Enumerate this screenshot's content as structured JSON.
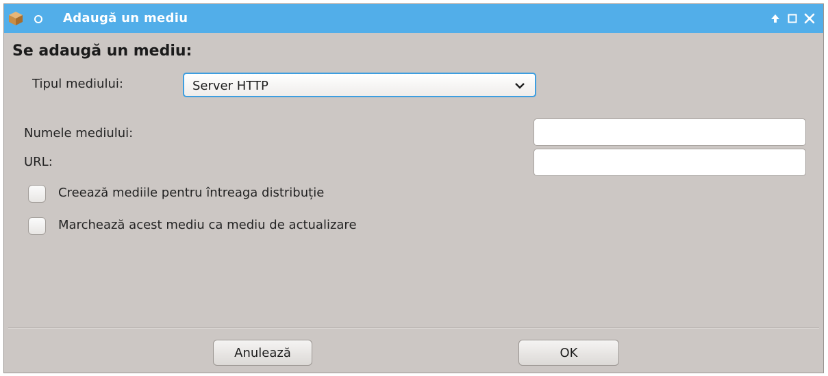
{
  "window": {
    "title": "Adaugă un mediu",
    "controls": [
      "keep-above-icon",
      "maximize-icon",
      "close-icon"
    ],
    "app_icon": "package-icon",
    "menu_icon": "circle-icon",
    "titlebar_color": "#52aee9"
  },
  "form": {
    "heading": "Se adaugă un mediu:",
    "media_type_label": "Tipul mediului:",
    "media_type_value": "Server HTTP",
    "media_name_label": "Numele mediului:",
    "media_name_value": "",
    "url_label": "URL:",
    "url_value": "",
    "checkboxes": [
      {
        "label": "Creează mediile pentru întreaga distribuție",
        "checked": false
      },
      {
        "label": "Marchează acest mediu ca mediu de actualizare",
        "checked": false
      }
    ]
  },
  "buttons": {
    "cancel": "Anulează",
    "ok": "OK"
  }
}
